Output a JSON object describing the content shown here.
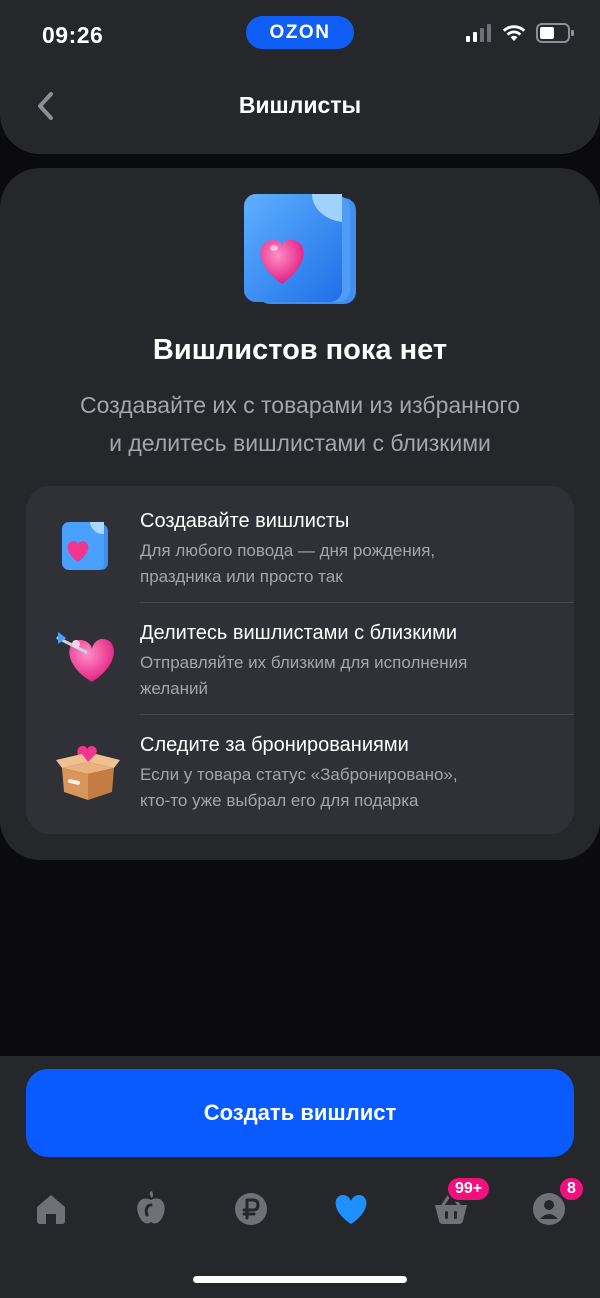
{
  "status_bar": {
    "time": "09:26",
    "app_badge": "OZON",
    "icons": [
      "signal-icon",
      "wifi-icon",
      "battery-icon"
    ]
  },
  "nav": {
    "title": "Вишлисты",
    "back_icon": "chevron-left-icon"
  },
  "empty_state": {
    "title": "Вишлистов пока нет",
    "subtitle_line1": "Создавайте их с товарами из избранного",
    "subtitle_line2": "и делитесь вишлистами с близкими"
  },
  "features": [
    {
      "icon": "wishlist-doc-icon",
      "title": "Создавайте вишлисты",
      "desc_line1": "Для любого повода — дня рождения,",
      "desc_line2": "праздника или просто так"
    },
    {
      "icon": "heart-arrow-icon",
      "title": "Делитесь вишлистами с близкими",
      "desc_line1": "Отправляйте их близким для исполнения",
      "desc_line2": "желаний"
    },
    {
      "icon": "gift-box-icon",
      "title": "Следите за бронированиями",
      "desc_line1": "Если у товара статус «Забронировано»,",
      "desc_line2": "кто-то уже выбрал его для подарка"
    }
  ],
  "create_button": {
    "label": "Создать вишлист"
  },
  "tabbar": {
    "tabs": [
      {
        "icon": "home-icon"
      },
      {
        "icon": "fresh-icon"
      },
      {
        "icon": "ruble-icon"
      },
      {
        "icon": "heart-icon",
        "active": true
      },
      {
        "icon": "cart-icon",
        "badge": "99+"
      },
      {
        "icon": "profile-icon",
        "badge": "8"
      }
    ]
  },
  "colors": {
    "accent": "#0a5bff",
    "badge": "#f1117e",
    "surface": "#26272b",
    "active_tab": "#1e90ff"
  }
}
